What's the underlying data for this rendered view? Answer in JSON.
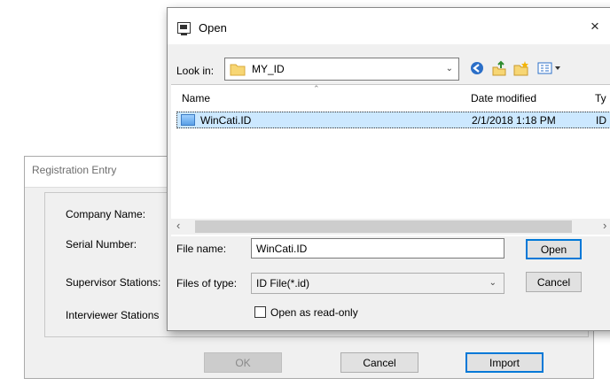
{
  "registration": {
    "title": "Registration Entry",
    "labels": [
      "Company Name:",
      "Serial Number:",
      "Supervisor Stations:",
      "Interviewer Stations"
    ],
    "ok_label": "OK",
    "cancel_label": "Cancel",
    "import_label": "Import"
  },
  "open_dialog": {
    "title": "Open",
    "close_glyph": "×",
    "look_in_label": "Look in:",
    "look_in_value": "MY_ID",
    "columns": [
      "Name",
      "Date modified",
      "Ty"
    ],
    "files": [
      {
        "name": "WinCati.ID",
        "date": "2/1/2018 1:18 PM",
        "type": "ID"
      }
    ],
    "file_name_label": "File name:",
    "file_name_value": "WinCati.ID",
    "files_of_type_label": "Files of type:",
    "files_of_type_value": "ID File(*.id)",
    "open_label": "Open",
    "cancel_label": "Cancel",
    "read_only_label": "Open as read-only"
  },
  "colors": {
    "accent": "#0078d7",
    "selection": "#cce8ff",
    "dialog_bg": "#f0f0f0"
  },
  "icons": [
    "app-icon",
    "folder-icon",
    "back-icon",
    "up-folder-icon",
    "new-folder-icon",
    "view-menu-icon",
    "file-icon",
    "close-icon"
  ]
}
